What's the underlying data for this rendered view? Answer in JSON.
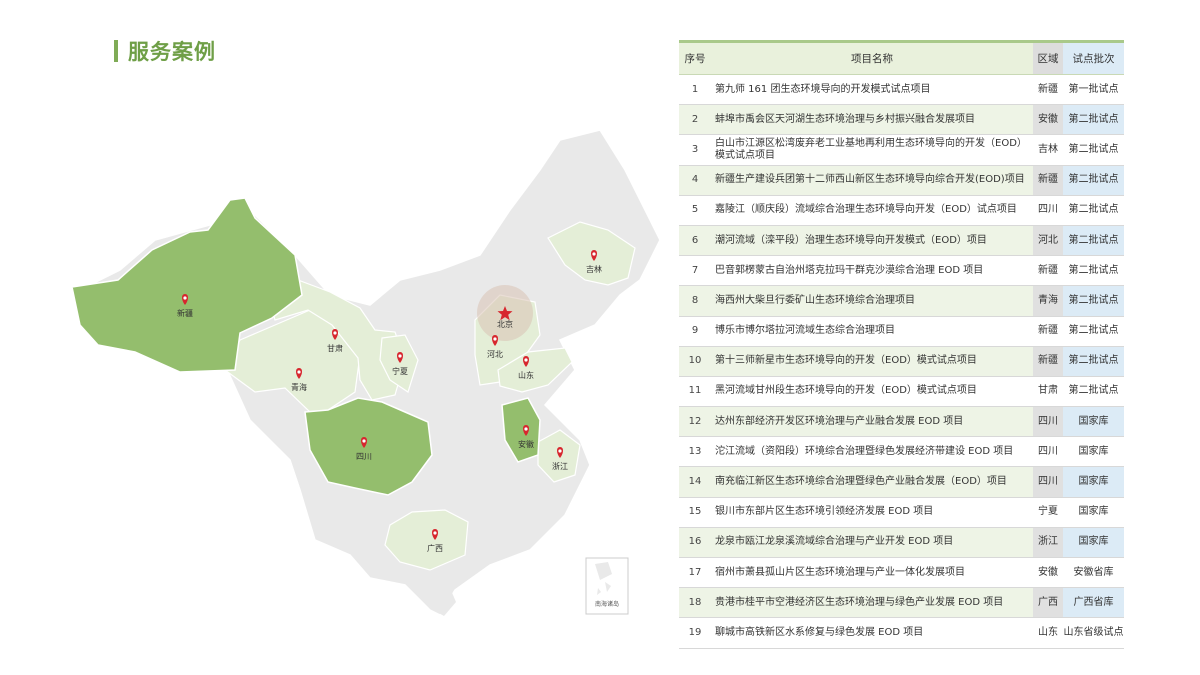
{
  "title": "服务案例",
  "table": {
    "headers": {
      "no": "序号",
      "name": "项目名称",
      "region": "区域",
      "batch": "试点批次"
    },
    "rows": [
      {
        "no": "1",
        "name": "第九师 161 团生态环境导向的开发模式试点项目",
        "region": "新疆",
        "batch": "第一批试点"
      },
      {
        "no": "2",
        "name": "蚌埠市禹会区天河湖生态环境治理与乡村振兴融合发展项目",
        "region": "安徽",
        "batch": "第二批试点"
      },
      {
        "no": "3",
        "name": "白山市江源区松湾废弃老工业基地再利用生态环境导向的开发（EOD）模式试点项目",
        "region": "吉林",
        "batch": "第二批试点"
      },
      {
        "no": "4",
        "name": "新疆生产建设兵团第十二师西山新区生态环境导向综合开发(EOD)项目",
        "region": "新疆",
        "batch": "第二批试点"
      },
      {
        "no": "5",
        "name": "嘉陵江（顺庆段）流域综合治理生态环境导向开发（EOD）试点项目",
        "region": "四川",
        "batch": "第二批试点"
      },
      {
        "no": "6",
        "name": "潮河流域（滦平段）治理生态环境导向开发模式（EOD）项目",
        "region": "河北",
        "batch": "第二批试点"
      },
      {
        "no": "7",
        "name": "巴音郭楞蒙古自治州塔克拉玛干群克沙漠综合治理 EOD 项目",
        "region": "新疆",
        "batch": "第二批试点"
      },
      {
        "no": "8",
        "name": "海西州大柴旦行委矿山生态环境综合治理项目",
        "region": "青海",
        "batch": "第二批试点"
      },
      {
        "no": "9",
        "name": "博乐市博尔塔拉河流域生态综合治理项目",
        "region": "新疆",
        "batch": "第二批试点"
      },
      {
        "no": "10",
        "name": "第十三师新星市生态环境导向的开发（EOD）模式试点项目",
        "region": "新疆",
        "batch": "第二批试点"
      },
      {
        "no": "11",
        "name": "黑河流域甘州段生态环境导向的开发（EOD）模式试点项目",
        "region": "甘肃",
        "batch": "第二批试点"
      },
      {
        "no": "12",
        "name": "达州东部经济开发区环境治理与产业融合发展 EOD 项目",
        "region": "四川",
        "batch": "国家库"
      },
      {
        "no": "13",
        "name": "沱江流域（资阳段）环境综合治理暨绿色发展经济带建设 EOD 项目",
        "region": "四川",
        "batch": "国家库"
      },
      {
        "no": "14",
        "name": "南充临江新区生态环境综合治理暨绿色产业融合发展（EOD）项目",
        "region": "四川",
        "batch": "国家库"
      },
      {
        "no": "15",
        "name": "银川市东部片区生态环境引领经济发展 EOD 项目",
        "region": "宁夏",
        "batch": "国家库"
      },
      {
        "no": "16",
        "name": "龙泉市瓯江龙泉溪流域综合治理与产业开发 EOD 项目",
        "region": "浙江",
        "batch": "国家库"
      },
      {
        "no": "17",
        "name": "宿州市萧县孤山片区生态环境治理与产业一体化发展项目",
        "region": "安徽",
        "batch": "安徽省库"
      },
      {
        "no": "18",
        "name": "贵港市桂平市空港经济区生态环境治理与绿色产业发展 EOD 项目",
        "region": "广西",
        "batch": "广西省库"
      },
      {
        "no": "19",
        "name": "聊城市高铁新区水系修复与绿色发展 EOD 项目",
        "region": "山东",
        "batch": "山东省级试点"
      }
    ]
  },
  "map": {
    "capital": "北京",
    "provinces": [
      "新疆",
      "甘肃",
      "青海",
      "宁夏",
      "四川",
      "广西",
      "河北",
      "山东",
      "安徽",
      "浙江",
      "吉林"
    ],
    "inset_label": "南海诸岛",
    "colors": {
      "dark": "#94be6d",
      "light": "#e4eed7",
      "base": "#e9e9e9",
      "pin": "#d7262e",
      "title": "#6f9f47"
    }
  }
}
